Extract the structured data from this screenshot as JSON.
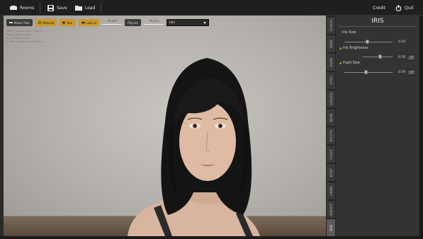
{
  "topbar": {
    "rooms_label": "Rooms",
    "save_label": "Save",
    "load_label": "Load",
    "credit_label": "Credit",
    "quit_label": "Quit"
  },
  "toolbar": {
    "mode_label": "Mode (Tab)",
    "material_label": "Material",
    "hair_label": "Hair",
    "look_at_label": "Look at",
    "health_label": "Health",
    "physics_label": "Physics",
    "muscle_label": "Muscle",
    "pose_select_value": "Idle"
  },
  "hints": [
    "RMB + Mouse Move: Rotate",
    "Mouse Scroll: Zoom",
    "B / E: Toggle Room",
    "",
    "T: RMB + Right Mouse Button"
  ],
  "tabs": [
    {
      "label": "SCALES"
    },
    {
      "label": "BASE"
    },
    {
      "label": "HEAD"
    },
    {
      "label": "EYES"
    },
    {
      "label": "LASHES"
    },
    {
      "label": "NOSE"
    },
    {
      "label": "MOUTH"
    },
    {
      "label": "CHEST"
    },
    {
      "label": "BODY"
    },
    {
      "label": "LIMBS"
    },
    {
      "label": "BREAST"
    },
    {
      "label": "IRIS"
    }
  ],
  "panel": {
    "title": "IRIS",
    "iris_size_label": "Iris Size",
    "iris_size_value": "0.19",
    "iris_size_fraction": 0.19,
    "iris_brightness_label": "Iris Brightness",
    "iris_brightness_value": "0.76",
    "iris_brightness_fraction": 0.76,
    "pupil_size_label": "Pupil Size",
    "pupil_size_value": "0.79",
    "pupil_size_fraction": 0.79
  },
  "colors": {
    "accent_gold": "#c99a2a",
    "panel_bg": "#333333"
  }
}
